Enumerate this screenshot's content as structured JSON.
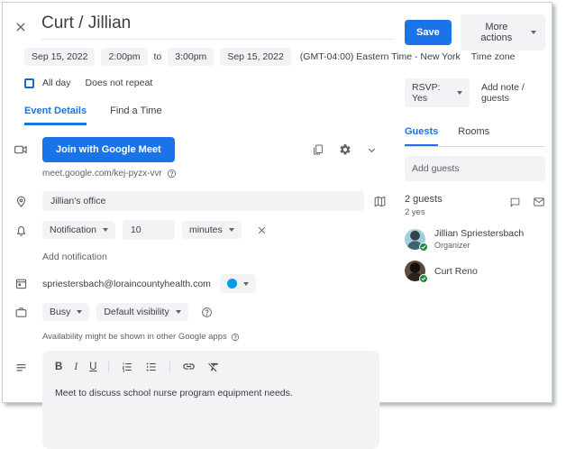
{
  "header": {
    "title": "Curt / Jillian"
  },
  "datetime": {
    "start_date": "Sep 15, 2022",
    "start_time": "2:00pm",
    "to_label": "to",
    "end_time": "3:00pm",
    "end_date": "Sep 15, 2022",
    "timezone": "(GMT-04:00) Eastern Time - New York",
    "timezone_button": "Time zone",
    "all_day_label": "All day",
    "recurrence": "Does not repeat"
  },
  "tabs": {
    "event_details": "Event Details",
    "find_a_time": "Find a Time"
  },
  "meet": {
    "join_button": "Join with Google Meet",
    "link": "meet.google.com/kej-pyzx-vvr"
  },
  "location": {
    "value": "Jillian's office"
  },
  "notification": {
    "type": "Notification",
    "value": "10",
    "unit": "minutes",
    "add_label": "Add notification"
  },
  "calendar": {
    "email": "spriestersbach@loraincountyhealth.com",
    "color": "#039be5"
  },
  "availability": {
    "busy": "Busy",
    "visibility": "Default visibility",
    "note": "Availability might be shown in other Google apps"
  },
  "description": {
    "toolbar": {
      "bold": "B",
      "italic": "I",
      "underline": "U"
    },
    "text": "Meet to discuss school nurse program equipment needs."
  },
  "actions": {
    "save": "Save",
    "more": "More actions"
  },
  "rsvp": {
    "value": "RSVP: Yes",
    "add_note": "Add note / guests"
  },
  "guests_panel": {
    "tab_guests": "Guests",
    "tab_rooms": "Rooms",
    "add_placeholder": "Add guests",
    "count": "2 guests",
    "yes_count": "2 yes",
    "guests": [
      {
        "name": "Jillian Spriestersbach",
        "role": "Organizer"
      },
      {
        "name": "Curt Reno",
        "role": ""
      }
    ]
  },
  "colors": {
    "accent": "#1a73e8",
    "chip_bg": "#f1f3f4",
    "calendar_dot": "#039be5",
    "check_green": "#1e8e3e"
  }
}
